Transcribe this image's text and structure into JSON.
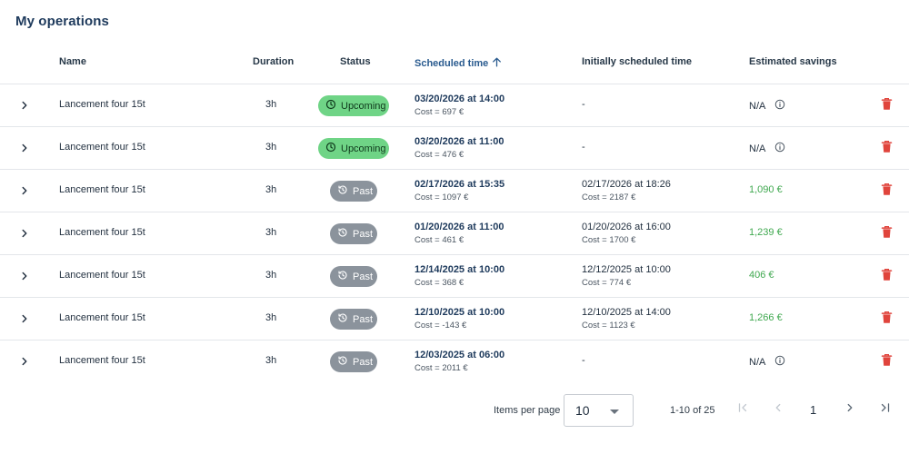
{
  "page": {
    "title": "My operations"
  },
  "table": {
    "columns": {
      "name": "Name",
      "duration": "Duration",
      "status": "Status",
      "scheduled": "Scheduled time",
      "initial": "Initially scheduled time",
      "savings": "Estimated savings"
    },
    "sort": {
      "column": "scheduled",
      "direction": "ascending",
      "icon": "arrow-up-icon"
    },
    "rows": [
      {
        "name": "Lancement four 15t",
        "duration": "3h",
        "status": "Upcoming",
        "scheduled": "03/20/2026 at 14:00",
        "scheduled_cost": "Cost = 697 €",
        "initial": "-",
        "initial_cost": "",
        "savings": "N/A"
      },
      {
        "name": "Lancement four 15t",
        "duration": "3h",
        "status": "Upcoming",
        "scheduled": "03/20/2026 at 11:00",
        "scheduled_cost": "Cost = 476 €",
        "initial": "-",
        "initial_cost": "",
        "savings": "N/A"
      },
      {
        "name": "Lancement four 15t",
        "duration": "3h",
        "status": "Past",
        "scheduled": "02/17/2026 at 15:35",
        "scheduled_cost": "Cost = 1097 €",
        "initial": "02/17/2026 at 18:26",
        "initial_cost": "Cost = 2187 €",
        "savings": "1,090 €"
      },
      {
        "name": "Lancement four 15t",
        "duration": "3h",
        "status": "Past",
        "scheduled": "01/20/2026 at 11:00",
        "scheduled_cost": "Cost = 461 €",
        "initial": "01/20/2026 at 16:00",
        "initial_cost": "Cost = 1700 €",
        "savings": "1,239 €"
      },
      {
        "name": "Lancement four 15t",
        "duration": "3h",
        "status": "Past",
        "scheduled": "12/14/2025 at 10:00",
        "scheduled_cost": "Cost = 368 €",
        "initial": "12/12/2025 at 10:00",
        "initial_cost": "Cost = 774 €",
        "savings": "406 €"
      },
      {
        "name": "Lancement four 15t",
        "duration": "3h",
        "status": "Past",
        "scheduled": "12/10/2025 at 10:00",
        "scheduled_cost": "Cost = -143 €",
        "initial": "12/10/2025 at 14:00",
        "initial_cost": "Cost = 1123 €",
        "savings": "1,266 €"
      },
      {
        "name": "Lancement four 15t",
        "duration": "3h",
        "status": "Past",
        "scheduled": "12/03/2025 at 06:00",
        "scheduled_cost": "Cost = 2011 €",
        "initial": "-",
        "initial_cost": "",
        "savings": "N/A"
      }
    ]
  },
  "pagination": {
    "items_per_page_label": "Items per page",
    "items_per_page": "10",
    "range": "1-10 of 25",
    "current_page": "1"
  },
  "icons": {
    "expand": "chevron-right-icon",
    "upcoming": "clock-icon",
    "past": "history-icon",
    "info": "info-icon",
    "delete": "trash-icon",
    "first": "first-page-icon",
    "prev": "chevron-left-icon",
    "next": "chevron-right-icon",
    "last": "last-page-icon"
  },
  "colors": {
    "title": "#1e3a5c",
    "upcoming_badge": "#6fd486",
    "past_badge": "#8b939c",
    "positive_savings": "#3fa84f",
    "delete": "#e0443c"
  }
}
